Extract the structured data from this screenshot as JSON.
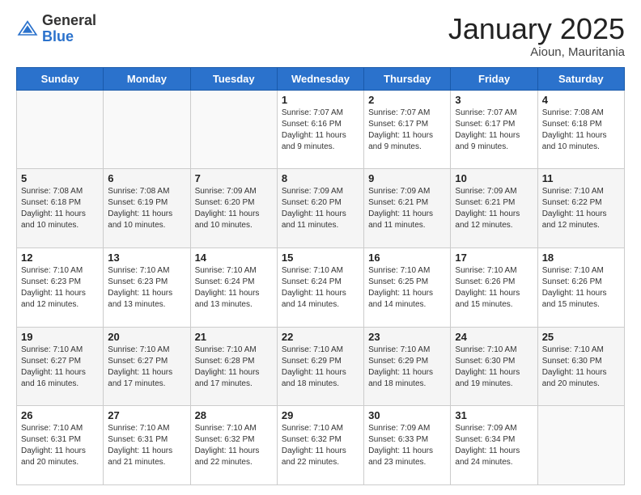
{
  "logo": {
    "general": "General",
    "blue": "Blue"
  },
  "header": {
    "title": "January 2025",
    "subtitle": "Aioun, Mauritania"
  },
  "days_of_week": [
    "Sunday",
    "Monday",
    "Tuesday",
    "Wednesday",
    "Thursday",
    "Friday",
    "Saturday"
  ],
  "weeks": [
    [
      {
        "day": "",
        "info": ""
      },
      {
        "day": "",
        "info": ""
      },
      {
        "day": "",
        "info": ""
      },
      {
        "day": "1",
        "info": "Sunrise: 7:07 AM\nSunset: 6:16 PM\nDaylight: 11 hours\nand 9 minutes."
      },
      {
        "day": "2",
        "info": "Sunrise: 7:07 AM\nSunset: 6:17 PM\nDaylight: 11 hours\nand 9 minutes."
      },
      {
        "day": "3",
        "info": "Sunrise: 7:07 AM\nSunset: 6:17 PM\nDaylight: 11 hours\nand 9 minutes."
      },
      {
        "day": "4",
        "info": "Sunrise: 7:08 AM\nSunset: 6:18 PM\nDaylight: 11 hours\nand 10 minutes."
      }
    ],
    [
      {
        "day": "5",
        "info": "Sunrise: 7:08 AM\nSunset: 6:18 PM\nDaylight: 11 hours\nand 10 minutes."
      },
      {
        "day": "6",
        "info": "Sunrise: 7:08 AM\nSunset: 6:19 PM\nDaylight: 11 hours\nand 10 minutes."
      },
      {
        "day": "7",
        "info": "Sunrise: 7:09 AM\nSunset: 6:20 PM\nDaylight: 11 hours\nand 10 minutes."
      },
      {
        "day": "8",
        "info": "Sunrise: 7:09 AM\nSunset: 6:20 PM\nDaylight: 11 hours\nand 11 minutes."
      },
      {
        "day": "9",
        "info": "Sunrise: 7:09 AM\nSunset: 6:21 PM\nDaylight: 11 hours\nand 11 minutes."
      },
      {
        "day": "10",
        "info": "Sunrise: 7:09 AM\nSunset: 6:21 PM\nDaylight: 11 hours\nand 12 minutes."
      },
      {
        "day": "11",
        "info": "Sunrise: 7:10 AM\nSunset: 6:22 PM\nDaylight: 11 hours\nand 12 minutes."
      }
    ],
    [
      {
        "day": "12",
        "info": "Sunrise: 7:10 AM\nSunset: 6:23 PM\nDaylight: 11 hours\nand 12 minutes."
      },
      {
        "day": "13",
        "info": "Sunrise: 7:10 AM\nSunset: 6:23 PM\nDaylight: 11 hours\nand 13 minutes."
      },
      {
        "day": "14",
        "info": "Sunrise: 7:10 AM\nSunset: 6:24 PM\nDaylight: 11 hours\nand 13 minutes."
      },
      {
        "day": "15",
        "info": "Sunrise: 7:10 AM\nSunset: 6:24 PM\nDaylight: 11 hours\nand 14 minutes."
      },
      {
        "day": "16",
        "info": "Sunrise: 7:10 AM\nSunset: 6:25 PM\nDaylight: 11 hours\nand 14 minutes."
      },
      {
        "day": "17",
        "info": "Sunrise: 7:10 AM\nSunset: 6:26 PM\nDaylight: 11 hours\nand 15 minutes."
      },
      {
        "day": "18",
        "info": "Sunrise: 7:10 AM\nSunset: 6:26 PM\nDaylight: 11 hours\nand 15 minutes."
      }
    ],
    [
      {
        "day": "19",
        "info": "Sunrise: 7:10 AM\nSunset: 6:27 PM\nDaylight: 11 hours\nand 16 minutes."
      },
      {
        "day": "20",
        "info": "Sunrise: 7:10 AM\nSunset: 6:27 PM\nDaylight: 11 hours\nand 17 minutes."
      },
      {
        "day": "21",
        "info": "Sunrise: 7:10 AM\nSunset: 6:28 PM\nDaylight: 11 hours\nand 17 minutes."
      },
      {
        "day": "22",
        "info": "Sunrise: 7:10 AM\nSunset: 6:29 PM\nDaylight: 11 hours\nand 18 minutes."
      },
      {
        "day": "23",
        "info": "Sunrise: 7:10 AM\nSunset: 6:29 PM\nDaylight: 11 hours\nand 18 minutes."
      },
      {
        "day": "24",
        "info": "Sunrise: 7:10 AM\nSunset: 6:30 PM\nDaylight: 11 hours\nand 19 minutes."
      },
      {
        "day": "25",
        "info": "Sunrise: 7:10 AM\nSunset: 6:30 PM\nDaylight: 11 hours\nand 20 minutes."
      }
    ],
    [
      {
        "day": "26",
        "info": "Sunrise: 7:10 AM\nSunset: 6:31 PM\nDaylight: 11 hours\nand 20 minutes."
      },
      {
        "day": "27",
        "info": "Sunrise: 7:10 AM\nSunset: 6:31 PM\nDaylight: 11 hours\nand 21 minutes."
      },
      {
        "day": "28",
        "info": "Sunrise: 7:10 AM\nSunset: 6:32 PM\nDaylight: 11 hours\nand 22 minutes."
      },
      {
        "day": "29",
        "info": "Sunrise: 7:10 AM\nSunset: 6:32 PM\nDaylight: 11 hours\nand 22 minutes."
      },
      {
        "day": "30",
        "info": "Sunrise: 7:09 AM\nSunset: 6:33 PM\nDaylight: 11 hours\nand 23 minutes."
      },
      {
        "day": "31",
        "info": "Sunrise: 7:09 AM\nSunset: 6:34 PM\nDaylight: 11 hours\nand 24 minutes."
      },
      {
        "day": "",
        "info": ""
      }
    ]
  ]
}
